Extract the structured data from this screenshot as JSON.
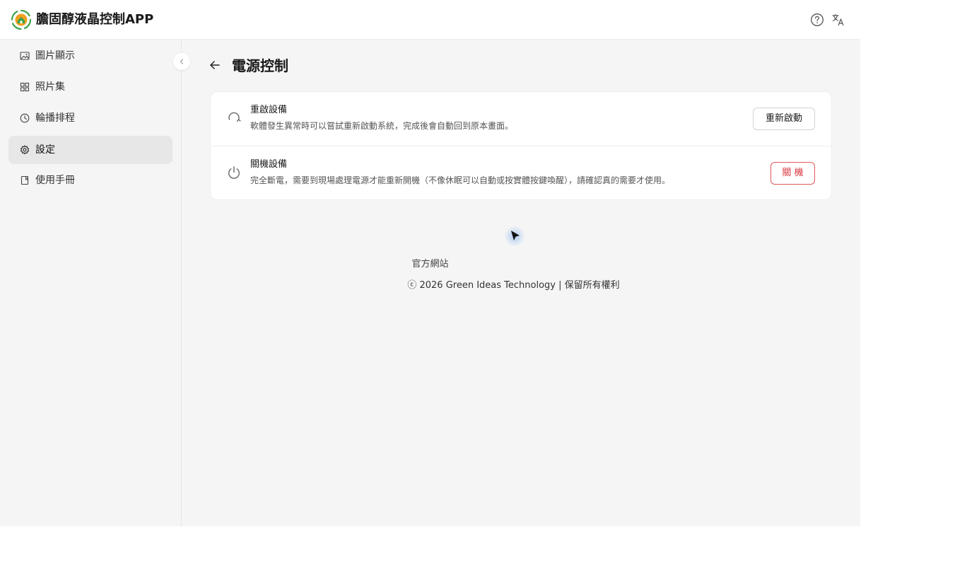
{
  "header": {
    "app_title": "膽固醇液晶控制APP",
    "help_icon": "help-circle-icon",
    "lang_icon": "translate-icon"
  },
  "sidebar": {
    "items": [
      {
        "label": "圖片顯示",
        "icon": "image-icon",
        "active": false
      },
      {
        "label": "照片集",
        "icon": "grid-icon",
        "active": false
      },
      {
        "label": "輪播排程",
        "icon": "clock-icon",
        "active": false
      },
      {
        "label": "設定",
        "icon": "gear-icon",
        "active": true
      },
      {
        "label": "使用手冊",
        "icon": "book-icon",
        "active": false
      }
    ],
    "collapse_icon": "chevron-left-icon"
  },
  "main": {
    "title": "電源控制",
    "rows": [
      {
        "title": "重啟設備",
        "desc": "軟體發生異常時可以嘗試重新啟動系統，完成後會自動回到原本畫面。",
        "button": "重新啟動",
        "icon": "refresh-icon"
      },
      {
        "title": "關機設備",
        "desc": "完全斷電，需要到現場處理電源才能重新開機（不像休眠可以自動或按實體按鍵喚醒），請確認真的需要才使用。",
        "button": "關 機",
        "icon": "power-icon"
      }
    ],
    "site_link": "官方網站",
    "footer_copyright": "ⓒ 2026 Green Ideas Technology | 保留所有權利"
  },
  "colors": {
    "danger": "#d9363e",
    "logo_green": "#3aa34a",
    "logo_orange": "#f0a020"
  }
}
